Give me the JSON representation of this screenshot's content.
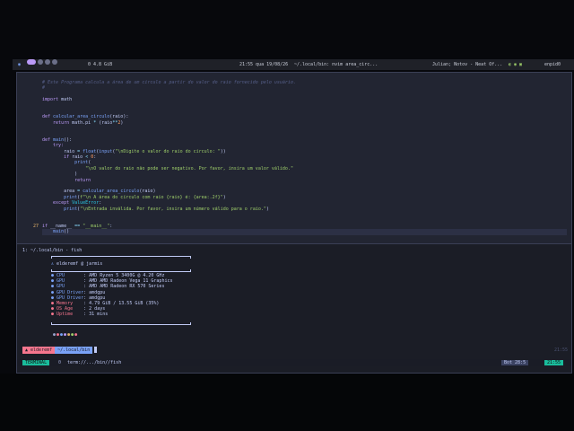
{
  "topbar": {
    "distro_icon": "arch-logo-icon",
    "sysinfo": "0 4.8 GiB",
    "clock": "21:55 qua 19/08/26",
    "window_title": "~/.local/bin: nvim area_circ...",
    "task_title": "Julian; Notov - Neat Of...",
    "tray_user": "enpid0"
  },
  "editor": {
    "line_numbers": [
      "",
      "",
      "",
      "",
      "",
      "",
      "",
      "",
      "",
      "",
      "",
      "",
      "",
      "",
      "",
      "",
      "",
      "",
      "",
      "",
      "",
      "",
      "",
      "",
      "",
      "27",
      ""
    ],
    "lines": [
      [
        {
          "t": "# Este Programa calcula a área de um círculo a partir do valor do raio fornecido pelo usuário.",
          "c": "cm"
        }
      ],
      [
        {
          "t": "#",
          "c": "cm"
        }
      ],
      [],
      [
        {
          "t": "import ",
          "c": "kw"
        },
        {
          "t": "math",
          "c": ""
        }
      ],
      [],
      [],
      [
        {
          "t": "def ",
          "c": "kw"
        },
        {
          "t": "calcular_area_circulo",
          "c": "fn"
        },
        {
          "t": "(raio):",
          "c": ""
        }
      ],
      [
        {
          "t": "    return ",
          "c": "kw"
        },
        {
          "t": "math.pi ",
          "c": ""
        },
        {
          "t": "* ",
          "c": "op"
        },
        {
          "t": "(raio",
          "c": ""
        },
        {
          "t": "**",
          "c": "op"
        },
        {
          "t": "2",
          "c": "nu"
        },
        {
          "t": ")",
          "c": ""
        }
      ],
      [],
      [],
      [
        {
          "t": "def ",
          "c": "kw"
        },
        {
          "t": "main",
          "c": "fn"
        },
        {
          "t": "():",
          "c": ""
        }
      ],
      [
        {
          "t": "    try:",
          "c": "kw"
        }
      ],
      [
        {
          "t": "        raio ",
          "c": ""
        },
        {
          "t": "= ",
          "c": "op"
        },
        {
          "t": "float",
          "c": "fn"
        },
        {
          "t": "(",
          "c": ""
        },
        {
          "t": "input",
          "c": "fn"
        },
        {
          "t": "(",
          "c": ""
        },
        {
          "t": "\"\\nDigite o valor do raio do círculo: \"",
          "c": "st"
        },
        {
          "t": "))",
          "c": ""
        }
      ],
      [
        {
          "t": "        if ",
          "c": "kw"
        },
        {
          "t": "raio ",
          "c": ""
        },
        {
          "t": "< ",
          "c": "op"
        },
        {
          "t": "0",
          "c": "nu"
        },
        {
          "t": ":",
          "c": ""
        }
      ],
      [
        {
          "t": "            print",
          "c": "fn"
        },
        {
          "t": "(",
          "c": ""
        }
      ],
      [
        {
          "t": "                \"\\nO valor do raio não pode ser negativo. Por favor, insira um valor válido.\"",
          "c": "st"
        }
      ],
      [
        {
          "t": "            )",
          "c": ""
        }
      ],
      [
        {
          "t": "            return",
          "c": "kw"
        }
      ],
      [],
      [
        {
          "t": "        area ",
          "c": ""
        },
        {
          "t": "= ",
          "c": "op"
        },
        {
          "t": "calcular_area_circulo",
          "c": "fn"
        },
        {
          "t": "(raio)",
          "c": ""
        }
      ],
      [
        {
          "t": "        print",
          "c": "fn"
        },
        {
          "t": "(",
          "c": ""
        },
        {
          "t": "f\"\\n A área do círculo com raio {raio} é: {area:.2f}\"",
          "c": "st"
        },
        {
          "t": ")",
          "c": ""
        }
      ],
      [
        {
          "t": "    except ",
          "c": "kw"
        },
        {
          "t": "ValueError",
          "c": "ex"
        },
        {
          "t": ":",
          "c": ""
        }
      ],
      [
        {
          "t": "        print",
          "c": "fn"
        },
        {
          "t": "(",
          "c": ""
        },
        {
          "t": "\"\\nEntrada inválida. Por favor, insira um número válido para o raio.\"",
          "c": "st"
        },
        {
          "t": ")",
          "c": ""
        }
      ],
      [],
      [],
      [
        {
          "t": "if ",
          "c": "kw"
        },
        {
          "t": "__name__ ",
          "c": ""
        },
        {
          "t": "== ",
          "c": "op"
        },
        {
          "t": "\"__main__\"",
          "c": "st"
        },
        {
          "t": ":",
          "c": ""
        }
      ],
      [
        {
          "t": "    main",
          "c": "fn"
        },
        {
          "t": "()",
          "c": ""
        }
      ]
    ],
    "cursor_line_index": 26
  },
  "terminal": {
    "tab_title": "1: ~/.local/bin - fish",
    "user_host": "elderemf @ jarmis",
    "fetch": [
      {
        "icon": "cpu-icon",
        "key": "CPU",
        "value": ": AMD Ryzen 5 3400G @ 4.20 GHz"
      },
      {
        "icon": "gpu-icon",
        "key": "GPU",
        "value": ": AMD AMD Radeon Vega 11 Graphics"
      },
      {
        "icon": "gpu-icon",
        "key": "GPU",
        "value": ": AMD AMD Radeon RX 570 Series"
      },
      {
        "icon": "gpu-driver-icon",
        "key": "GPU Driver",
        "value": ": amdgpu"
      },
      {
        "icon": "gpu-driver-icon",
        "key": "GPU Driver",
        "value": ": amdgpu"
      },
      {
        "icon": "memory-icon",
        "key": "Memory",
        "value": ": 4.79 GiB / 13.55 GiB (35%)"
      },
      {
        "icon": "os-age-icon",
        "key": "OS Age",
        "value": ": 2 days"
      },
      {
        "icon": "uptime-icon",
        "key": "Uptime",
        "value": ": 31 mins"
      }
    ],
    "color_dots": [
      "#9aa5ce",
      "#f7768e",
      "#7aa2f7",
      "#bb9af7",
      "#e0af68",
      "#9ece6a",
      "#f7768e"
    ],
    "prompt": {
      "user": "elderemf",
      "path": "~/.local/bin",
      "right_time": "21:55"
    }
  },
  "statusline": {
    "mode": "TERMINAL",
    "file": "term://.../bin//fish",
    "file_prefix": "0",
    "position": "Bot  28:5",
    "time": "21:55"
  },
  "colors": {
    "accent": "#7aa2f7",
    "pink": "#f7768e",
    "green": "#9ece6a",
    "purple": "#bb9af7"
  }
}
